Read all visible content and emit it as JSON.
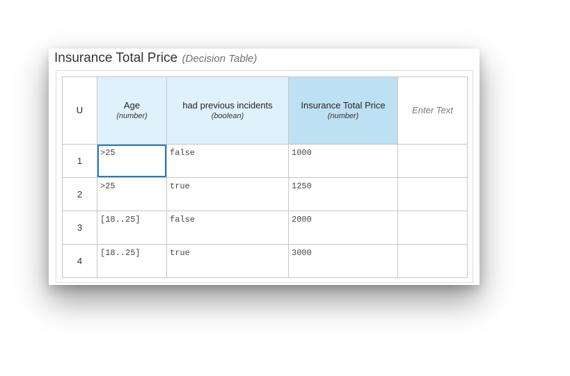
{
  "table": {
    "title": "Insurance Total Price",
    "subtitle": "(Decision Table)",
    "hit_policy": "U",
    "columns": [
      {
        "name": "Age",
        "type": "(number)",
        "kind": "input"
      },
      {
        "name": "had previous incidents",
        "type": "(boolean)",
        "kind": "input"
      },
      {
        "name": "Insurance Total Price",
        "type": "(number)",
        "kind": "output"
      }
    ],
    "annotation_placeholder": "Enter Text",
    "rows": [
      {
        "num": "1",
        "age": ">25",
        "incidents": "false",
        "price": "1000",
        "annotation": ""
      },
      {
        "num": "2",
        "age": ">25",
        "incidents": "true",
        "price": "1250",
        "annotation": ""
      },
      {
        "num": "3",
        "age": "[18..25]",
        "incidents": "false",
        "price": "2000",
        "annotation": ""
      },
      {
        "num": "4",
        "age": "[18..25]",
        "incidents": "true",
        "price": "3000",
        "annotation": ""
      }
    ],
    "selected_cell": {
      "row": "1",
      "column": "Age"
    }
  },
  "colors": {
    "input_header": "#dff1fb",
    "output_header": "#bde0f3",
    "selection": "#1f7cc4"
  }
}
